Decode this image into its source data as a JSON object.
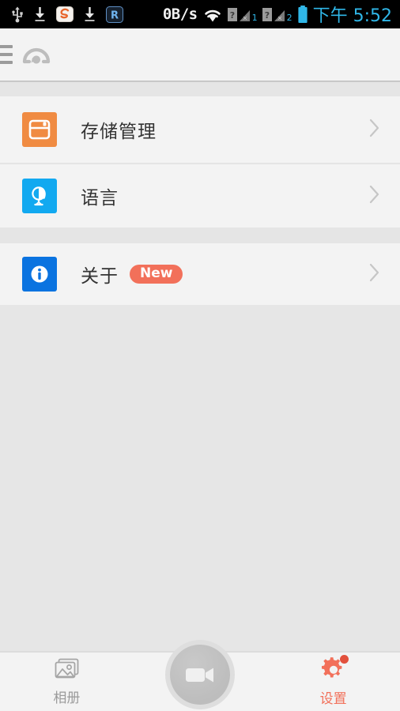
{
  "statusbar": {
    "left_icons": [
      "usb-icon",
      "download-icon",
      "sogou-icon",
      "download-icon",
      "r-app-icon"
    ],
    "network_speed": "0B/s",
    "wifi_icon": "wifi-icon",
    "sim1_label": "1",
    "sim2_label": "2",
    "battery_icon": "battery-icon",
    "clock": "下午 5:52",
    "clock_color": "#30b7e8"
  },
  "appbar": {
    "menu_icon": "hamburger-menu-icon",
    "logo_icon": "gauge-logo-icon"
  },
  "settings_list": {
    "items": [
      {
        "label": "存储管理",
        "icon": "storage-floppy-icon",
        "icon_color": "#f08b42",
        "badge": null,
        "chevron": "chevron-right-icon"
      },
      {
        "label": "语言",
        "icon": "globe-icon",
        "icon_color": "#12a9f0",
        "badge": null,
        "chevron": "chevron-right-icon"
      },
      {
        "label": "关于",
        "icon": "info-icon",
        "icon_color": "#0a73e0",
        "badge": "New",
        "badge_color": "#f2705a",
        "chevron": "chevron-right-icon"
      }
    ]
  },
  "tabbar": {
    "tabs": [
      {
        "label": "相册",
        "icon": "gallery-icon",
        "active": false
      },
      {
        "label": "设置",
        "icon": "gear-icon",
        "active": true,
        "has_dot": true
      }
    ],
    "record_button": {
      "icon": "video-camera-icon"
    },
    "active_color": "#f2705a",
    "inactive_color": "#9a9a9a"
  }
}
